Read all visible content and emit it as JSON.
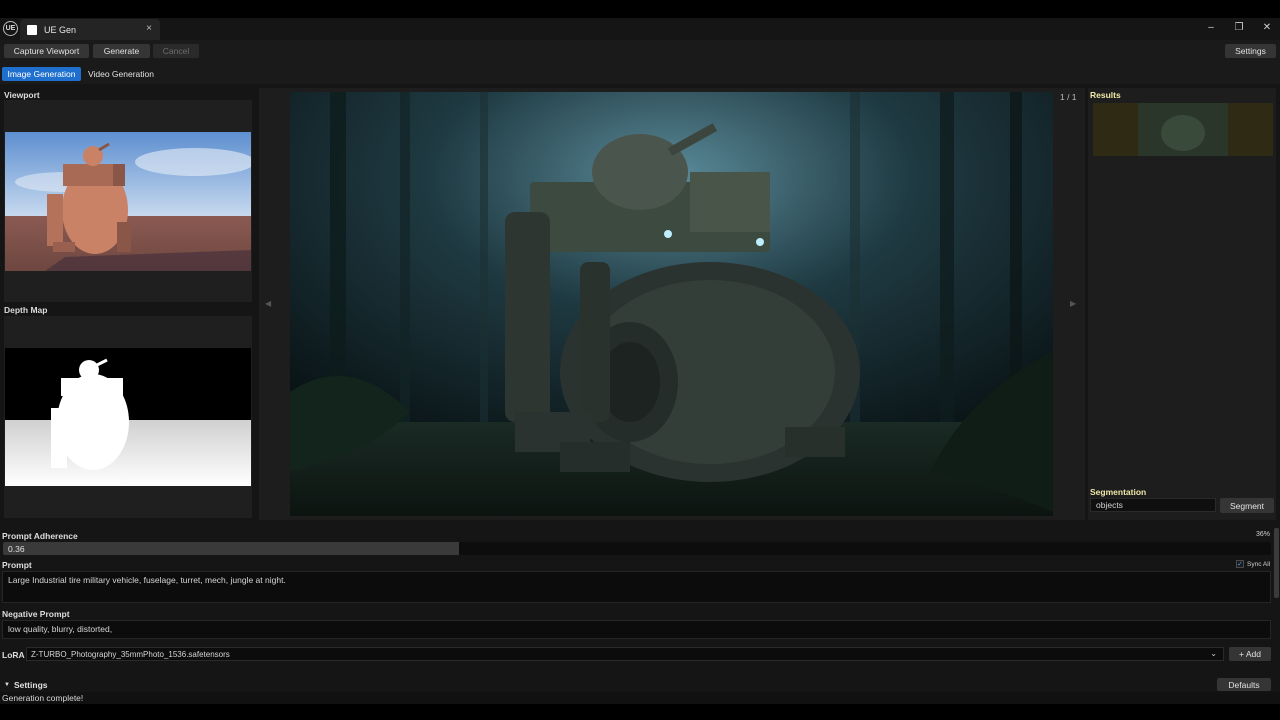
{
  "window": {
    "tab_title": "UE Gen",
    "tab_close": "×",
    "logo_text": "UE",
    "minimize": "–",
    "maximize": "❐",
    "close": "✕"
  },
  "toolbar": {
    "capture_label": "Capture Viewport",
    "generate_label": "Generate",
    "cancel_label": "Cancel",
    "settings_label": "Settings"
  },
  "tabs": [
    {
      "label": "Image Generation",
      "active": true
    },
    {
      "label": "Video Generation",
      "active": false
    }
  ],
  "left_panel": {
    "viewport_label": "Viewport",
    "depth_label": "Depth Map"
  },
  "viewer": {
    "counter": "1 / 1",
    "prev_icon": "◀",
    "next_icon": "▶"
  },
  "right_panel": {
    "results_label": "Results",
    "segmentation_label": "Segmentation",
    "segmentation_value": "objects",
    "segment_button": "Segment"
  },
  "controls": {
    "prompt_adherence_label": "Prompt Adherence",
    "prompt_adherence_value": "0.36",
    "prompt_adherence_percent": "36%",
    "prompt_adherence_fraction": 0.36,
    "prompt_label": "Prompt",
    "prompt_text": "Large Industrial tire military vehicle, fuselage, turret, mech, jungle at night.",
    "sync_all_label": "Sync All",
    "sync_all_checked": true,
    "negative_prompt_label": "Negative Prompt",
    "negative_prompt_text": "low quality, blurry, distorted,",
    "lora_label": "LoRA",
    "lora_value": "Z-TURBO_Photography_35mmPhoto_1536.safetensors",
    "add_button": "+ Add",
    "settings_section_label": "Settings",
    "defaults_button": "Defaults"
  },
  "status": {
    "text": "Generation complete!"
  },
  "colors": {
    "accent": "#1f6fcf",
    "section_label_highlight": "#f0e9a8"
  },
  "icons": {
    "dropdown": "chevron-down-icon",
    "expand": "triangle-down-icon",
    "check": "checkmark-icon"
  }
}
